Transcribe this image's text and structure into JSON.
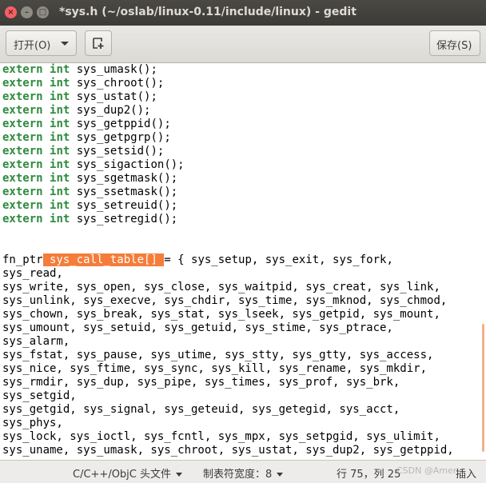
{
  "window": {
    "title": "*sys.h (~/oslab/linux-0.11/include/linux) - gedit",
    "buttons": {
      "close": "×",
      "minimize": "–",
      "maximize": "□"
    }
  },
  "toolbar": {
    "open_label": "打开(O)",
    "save_label": "保存(S)"
  },
  "editor": {
    "lines": [
      [
        {
          "t": "extern",
          "kw": true
        },
        {
          "t": " "
        },
        {
          "t": "int",
          "kw": true
        },
        {
          "t": " sys_umask();"
        }
      ],
      [
        {
          "t": "extern",
          "kw": true
        },
        {
          "t": " "
        },
        {
          "t": "int",
          "kw": true
        },
        {
          "t": " sys_chroot();"
        }
      ],
      [
        {
          "t": "extern",
          "kw": true
        },
        {
          "t": " "
        },
        {
          "t": "int",
          "kw": true
        },
        {
          "t": " sys_ustat();"
        }
      ],
      [
        {
          "t": "extern",
          "kw": true
        },
        {
          "t": " "
        },
        {
          "t": "int",
          "kw": true
        },
        {
          "t": " sys_dup2();"
        }
      ],
      [
        {
          "t": "extern",
          "kw": true
        },
        {
          "t": " "
        },
        {
          "t": "int",
          "kw": true
        },
        {
          "t": " sys_getppid();"
        }
      ],
      [
        {
          "t": "extern",
          "kw": true
        },
        {
          "t": " "
        },
        {
          "t": "int",
          "kw": true
        },
        {
          "t": " sys_getpgrp();"
        }
      ],
      [
        {
          "t": "extern",
          "kw": true
        },
        {
          "t": " "
        },
        {
          "t": "int",
          "kw": true
        },
        {
          "t": " sys_setsid();"
        }
      ],
      [
        {
          "t": "extern",
          "kw": true
        },
        {
          "t": " "
        },
        {
          "t": "int",
          "kw": true
        },
        {
          "t": " sys_sigaction();"
        }
      ],
      [
        {
          "t": "extern",
          "kw": true
        },
        {
          "t": " "
        },
        {
          "t": "int",
          "kw": true
        },
        {
          "t": " sys_sgetmask();"
        }
      ],
      [
        {
          "t": "extern",
          "kw": true
        },
        {
          "t": " "
        },
        {
          "t": "int",
          "kw": true
        },
        {
          "t": " sys_ssetmask();"
        }
      ],
      [
        {
          "t": "extern",
          "kw": true
        },
        {
          "t": " "
        },
        {
          "t": "int",
          "kw": true
        },
        {
          "t": " sys_setreuid();"
        }
      ],
      [
        {
          "t": "extern",
          "kw": true
        },
        {
          "t": " "
        },
        {
          "t": "int",
          "kw": true
        },
        {
          "t": " sys_setregid();"
        }
      ],
      [],
      [],
      [
        {
          "t": "fn_ptr"
        },
        {
          "t": " sys_call_table[] ",
          "hl": true
        },
        {
          "t": "= { sys_setup, sys_exit, sys_fork,"
        }
      ],
      [
        {
          "t": "sys_read,"
        }
      ],
      [
        {
          "t": "sys_write, sys_open, sys_close, sys_waitpid, sys_creat, sys_link,"
        }
      ],
      [
        {
          "t": "sys_unlink, sys_execve, sys_chdir, sys_time, sys_mknod, sys_chmod,"
        }
      ],
      [
        {
          "t": "sys_chown, sys_break, sys_stat, sys_lseek, sys_getpid, sys_mount,"
        }
      ],
      [
        {
          "t": "sys_umount, sys_setuid, sys_getuid, sys_stime, sys_ptrace,"
        }
      ],
      [
        {
          "t": "sys_alarm,"
        }
      ],
      [
        {
          "t": "sys_fstat, sys_pause, sys_utime, sys_stty, sys_gtty, sys_access,"
        }
      ],
      [
        {
          "t": "sys_nice, sys_ftime, sys_sync, sys_kill, sys_rename, sys_mkdir,"
        }
      ],
      [
        {
          "t": "sys_rmdir, sys_dup, sys_pipe, sys_times, sys_prof, sys_brk,"
        }
      ],
      [
        {
          "t": "sys_setgid,"
        }
      ],
      [
        {
          "t": "sys_getgid, sys_signal, sys_geteuid, sys_getegid, sys_acct,"
        }
      ],
      [
        {
          "t": "sys_phys,"
        }
      ],
      [
        {
          "t": "sys_lock, sys_ioctl, sys_fcntl, sys_mpx, sys_setpgid, sys_ulimit,"
        }
      ],
      [
        {
          "t": "sys_uname, sys_umask, sys_chroot, sys_ustat, sys_dup2, sys_getppid,"
        }
      ]
    ]
  },
  "statusbar": {
    "language": "C/C++/ObjC 头文件",
    "tab_width": "制表符宽度：8",
    "position": "行 75，列 25",
    "insert_mode": "插入",
    "watermark": "CSDN @Amer"
  },
  "colors": {
    "keyword": "#2e8b3e",
    "highlight": "#f57c3a",
    "close_button": "#f46067"
  }
}
